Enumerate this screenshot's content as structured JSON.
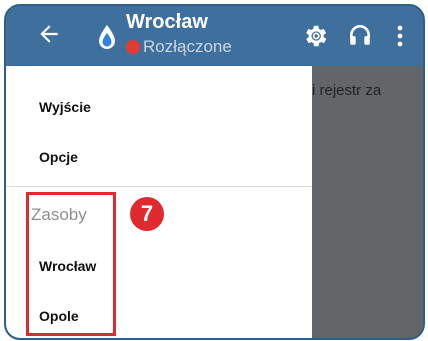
{
  "appbar": {
    "title": "Wrocław",
    "status": "Rozłączone",
    "accent_color": "#3f6f9c",
    "status_color": "#e53a2f",
    "icons": [
      "back-arrow-icon",
      "water-drop-icon",
      "gear-icon",
      "headset-icon",
      "more-vert-icon"
    ]
  },
  "background": {
    "text_fragment": "i rejestr za"
  },
  "drawer": {
    "items": [
      "Wyjście",
      "Opcje"
    ],
    "section_label": "Zasoby",
    "resources": [
      "Wrocław",
      "Opole"
    ]
  },
  "annotation": {
    "marker_number": "7",
    "color": "#df2b2f"
  }
}
